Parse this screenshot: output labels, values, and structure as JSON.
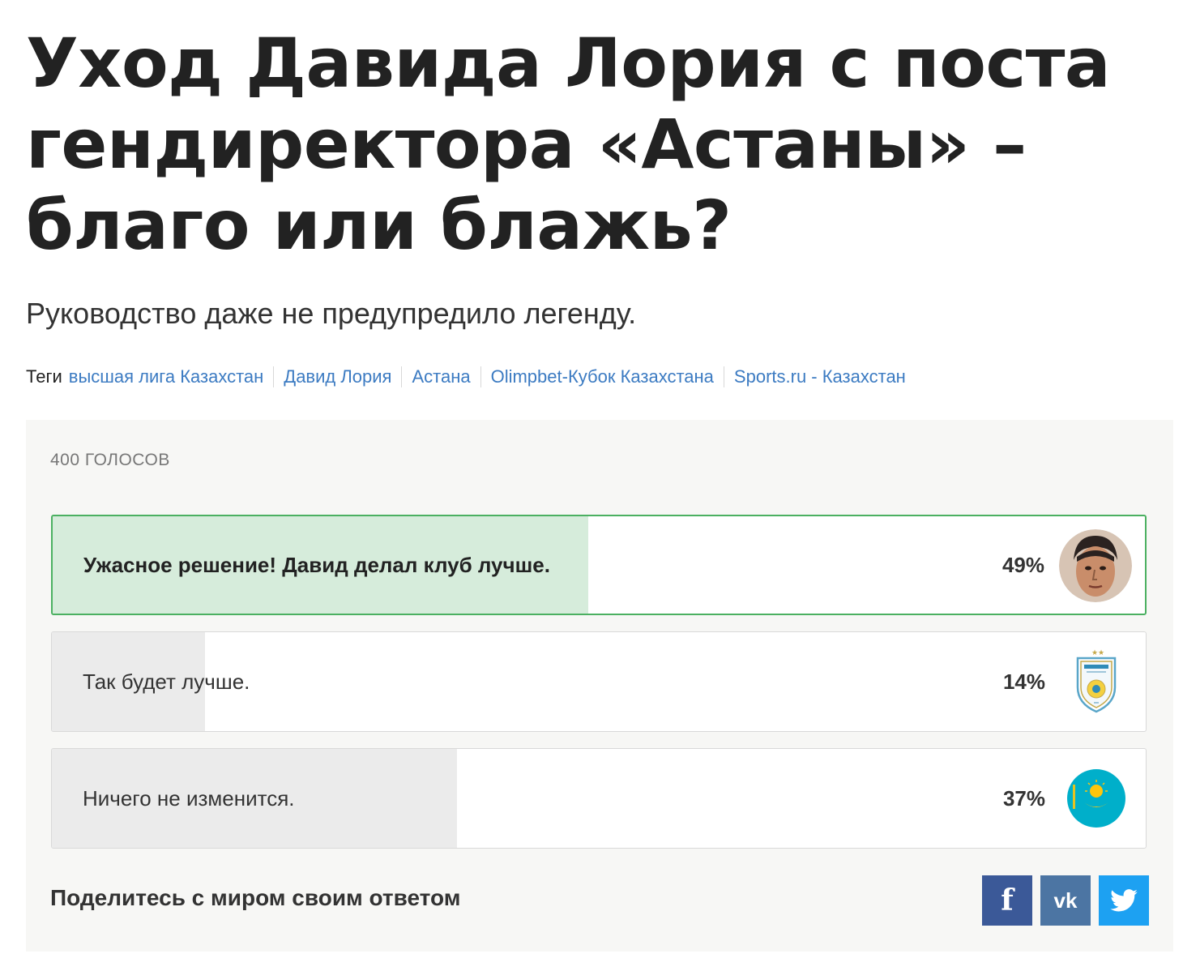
{
  "article": {
    "title": "Уход Давида Лория с поста гендиректора «Астаны» – благо или блажь?",
    "subtitle": "Руководство даже не предупредило легенду.",
    "tags_label": "Теги",
    "tags": [
      "высшая лига Казахстан",
      "Давид Лория",
      "Астана",
      "Olimpbet-Кубок Казахстана",
      "Sports.ru - Казахстан"
    ]
  },
  "poll": {
    "votes": "400 ГОЛОСОВ",
    "options": [
      {
        "label": "Ужасное решение! Давид делал клуб лучше.",
        "percent": "49%",
        "value": 49,
        "selected": true,
        "icon": "person-photo-icon"
      },
      {
        "label": "Так будет лучше.",
        "percent": "14%",
        "value": 14,
        "selected": false,
        "icon": "astana-club-logo-icon"
      },
      {
        "label": "Ничего не изменится.",
        "percent": "37%",
        "value": 37,
        "selected": false,
        "icon": "kazakhstan-flag-icon"
      }
    ],
    "share_text": "Поделитесь с миром своим ответом",
    "share_buttons": {
      "facebook": "f",
      "vk": "vk",
      "twitter": "twitter-bird-icon"
    },
    "colors": {
      "selected_border": "#4bb061",
      "selected_fill": "#d6ecdb",
      "fill": "#ebebeb",
      "facebook": "#3b5998",
      "vk": "#4c75a3",
      "twitter": "#1da1f2",
      "tag_link": "#3c7bc2"
    }
  }
}
